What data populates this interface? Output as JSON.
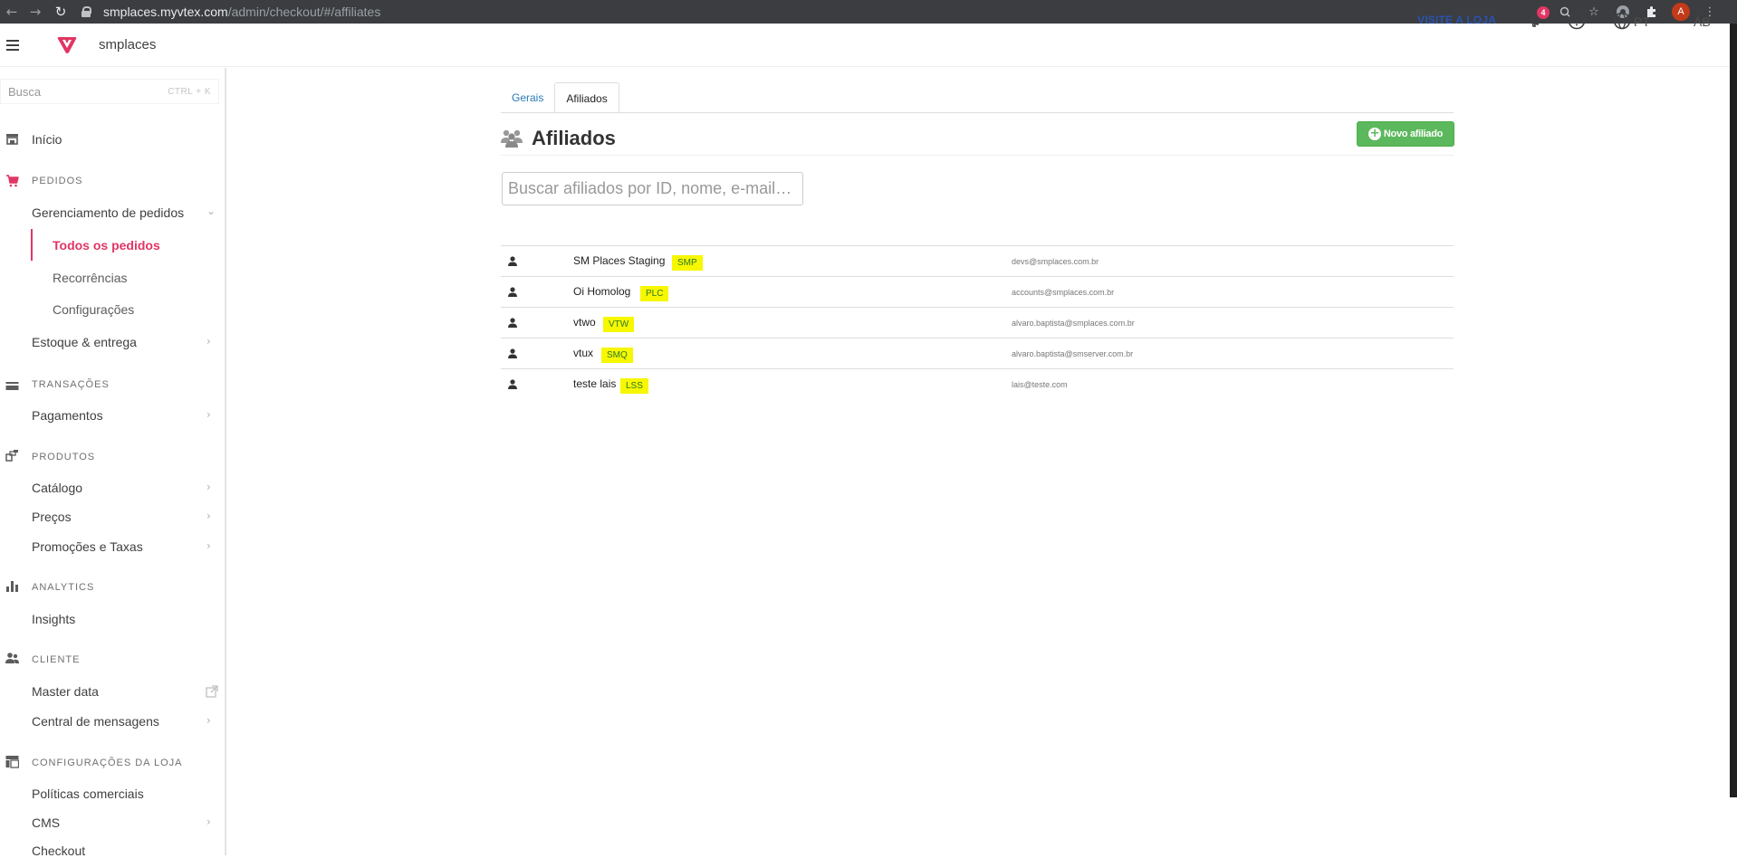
{
  "browser": {
    "url_host": "smplaces.myvtex.com",
    "url_path": "/admin/checkout/#/affiliates",
    "profile_initial": "A"
  },
  "topbar": {
    "store_name": "smplaces",
    "visit_store": "VISITE A LOJA",
    "notification_count": "4",
    "language": "PT",
    "user_initials": "ÁB"
  },
  "sidebar": {
    "search_placeholder": "Busca",
    "search_shortcut": "CTRL + K",
    "home": "Início",
    "pedidos": {
      "header": "PEDIDOS",
      "gerenciamento": "Gerenciamento de pedidos",
      "todos": "Todos os pedidos",
      "recorrencias": "Recorrências",
      "configuracoes": "Configurações",
      "estoque": "Estoque & entrega"
    },
    "transacoes": {
      "header": "TRANSAÇÕES",
      "pagamentos": "Pagamentos"
    },
    "produtos": {
      "header": "PRODUTOS",
      "catalogo": "Catálogo",
      "precos": "Preços",
      "promocoes": "Promoções e Taxas"
    },
    "analytics": {
      "header": "ANALYTICS",
      "insights": "Insights"
    },
    "cliente": {
      "header": "CLIENTE",
      "master_data": "Master data",
      "central": "Central de mensagens"
    },
    "loja": {
      "header": "CONFIGURAÇÕES DA LOJA",
      "politicas": "Políticas comerciais",
      "cms": "CMS",
      "checkout": "Checkout"
    }
  },
  "main": {
    "tabs": [
      "Gerais",
      "Afiliados"
    ],
    "active_tab": "Afiliados",
    "title": "Afiliados",
    "new_button": "Novo afiliado",
    "search_placeholder": "Buscar afiliados por ID, nome, e-mail…",
    "affiliates": [
      {
        "name": "SM Places Staging",
        "code": "SMP",
        "email": "devs@smplaces.com.br"
      },
      {
        "name": "Oi Homolog",
        "code": "PLC",
        "email": "accounts@smplaces.com.br"
      },
      {
        "name": "vtwo",
        "code": "VTW",
        "email": "alvaro.baptista@smplaces.com.br"
      },
      {
        "name": "vtux",
        "code": "SMQ",
        "email": "alvaro.baptista@smserver.com.br"
      },
      {
        "name": "teste lais",
        "code": "LSS",
        "email": "lais@teste.com"
      }
    ]
  },
  "colors": {
    "brand_pink": "#e13664",
    "link_blue": "#2953b2",
    "success_green": "#5cb85c",
    "highlight_yellow": "#f7f700"
  }
}
